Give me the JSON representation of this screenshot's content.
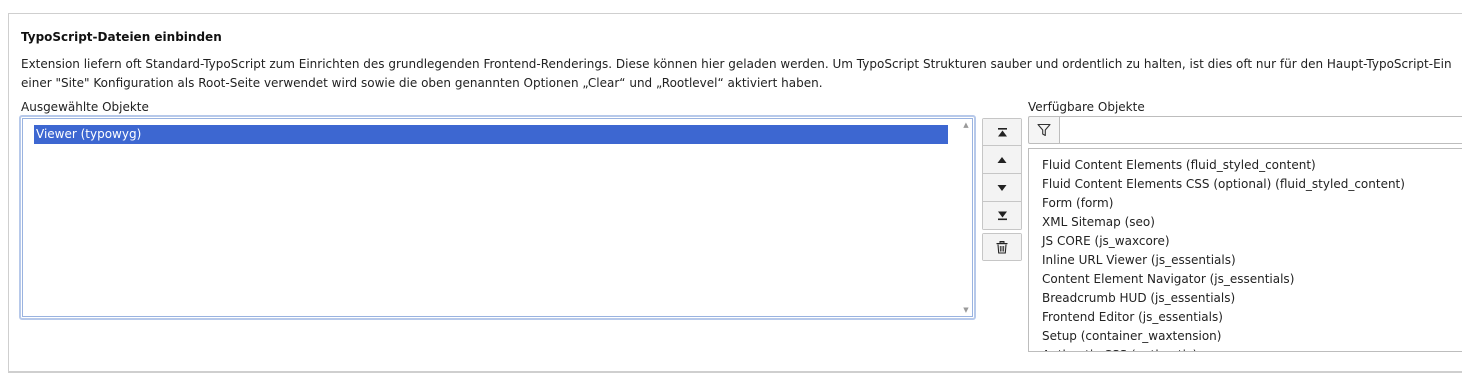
{
  "section": {
    "title": "TypoScript-Dateien einbinden",
    "description_line1": "Extension liefern oft Standard-TypoScript zum Einrichten des grundlegenden Frontend-Renderings. Diese können hier geladen werden. Um TypoScript Strukturen sauber und ordentlich zu halten, ist dies oft nur für den Haupt-TypoScript-Ein",
    "description_line2": "einer \"Site\" Konfiguration als Root-Seite verwendet wird sowie die oben genannten Optionen „Clear“ und „Rootlevel“ aktiviert haben."
  },
  "selected": {
    "label": "Ausgewählte Objekte",
    "items": [
      "Viewer (typowyg)"
    ]
  },
  "buttons": {
    "move_top": "move-to-top-icon",
    "move_up": "move-up-icon",
    "move_down": "move-down-icon",
    "move_bottom": "move-to-bottom-icon",
    "remove": "trash-icon"
  },
  "available": {
    "label": "Verfügbare Objekte",
    "filter_value": "",
    "filter_placeholder": "",
    "items": [
      "Fluid Content Elements (fluid_styled_content)",
      "Fluid Content Elements CSS (optional) (fluid_styled_content)",
      "Form (form)",
      "XML Sitemap (seo)",
      "JS CORE (js_waxcore)",
      "Inline URL Viewer (js_essentials)",
      "Content Element Navigator (js_essentials)",
      "Breadcrumb HUD (js_essentials)",
      "Frontend Editor (js_essentials)",
      "Setup (container_waxtension)",
      "Authentic CSS (authentic)"
    ]
  },
  "colors": {
    "selection_bg": "#3d67d1",
    "focus_border": "#b7c9ea"
  }
}
